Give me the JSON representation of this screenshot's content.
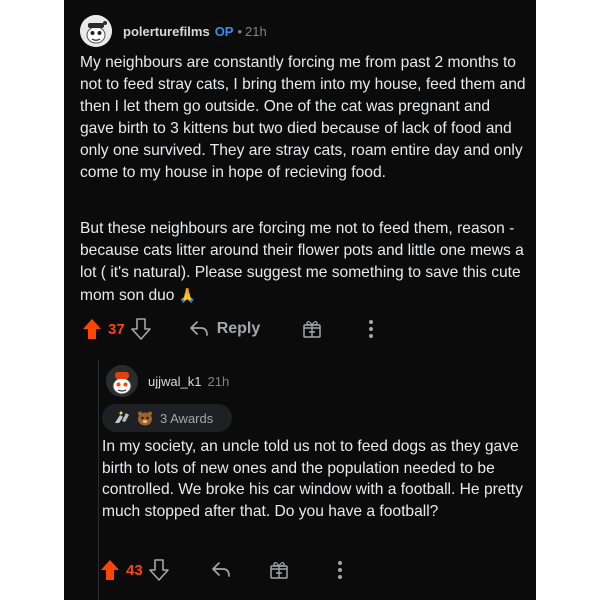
{
  "post": {
    "author": "polerturefilms",
    "op_badge": "OP",
    "separator": "•",
    "time": "21h",
    "paragraph_1": "My neighbours are constantly forcing me from past 2 months to not to feed stray cats, I bring them into my house, feed them and then I let them go outside. One of the cat was pregnant and gave birth to 3 kittens but two died because of lack of food and only one survived. They are stray cats, roam entire day and only come to my house in hope of recieving food.",
    "paragraph_2": "But these neighbours are forcing me not to feed them, reason - because cats litter around their flower pots and little one mews a lot ( it's natural). Please suggest me something to save this cute mom son duo",
    "emoji": "🙏",
    "votes": "37",
    "reply_label": "Reply"
  },
  "comment": {
    "author": "ujjwal_k1",
    "time": "21h",
    "awards_label": "3 Awards",
    "body": "In my society, an uncle told us not to feed dogs as they gave birth to lots of new ones and the population needed to be controlled. We broke his car window with a football. He pretty much stopped after that. Do you have a football?",
    "votes": "43"
  },
  "colors": {
    "background": "#0b0b0c",
    "upvote": "#ff4500",
    "op_badge": "#3a8fe8",
    "text": "#e8eaeb",
    "muted": "#818384"
  },
  "icons": {
    "upvote": "arrow-up-icon",
    "downvote": "arrow-down-icon",
    "reply": "reply-arrow-icon",
    "award": "gift-icon",
    "more": "more-vertical-icon"
  }
}
